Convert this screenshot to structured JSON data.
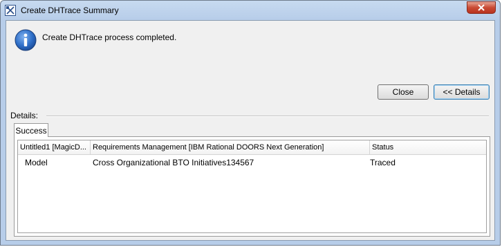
{
  "window": {
    "title": "Create DHTrace Summary",
    "app_icon": "dhtrace-app-icon",
    "close_icon": "close-icon"
  },
  "message": {
    "icon": "info-icon",
    "text": "Create DHTrace process completed."
  },
  "buttons": {
    "close_label": "Close",
    "details_label": "<< Details"
  },
  "details": {
    "label": "Details:",
    "tabs": [
      {
        "label": "Success"
      }
    ],
    "table": {
      "columns": [
        "Untitled1 [MagicD...",
        "Requirements Management [IBM Rational DOORS Next Generation]",
        "Status"
      ],
      "rows": [
        [
          "Model",
          "Cross Organizational BTO Initiatives134567",
          "Traced"
        ]
      ]
    }
  },
  "colors": {
    "title_bar": "#b7cde9",
    "client_background": "#f0f0f0",
    "close_button": "#c94a34",
    "default_button_border": "#3c7fb1"
  }
}
